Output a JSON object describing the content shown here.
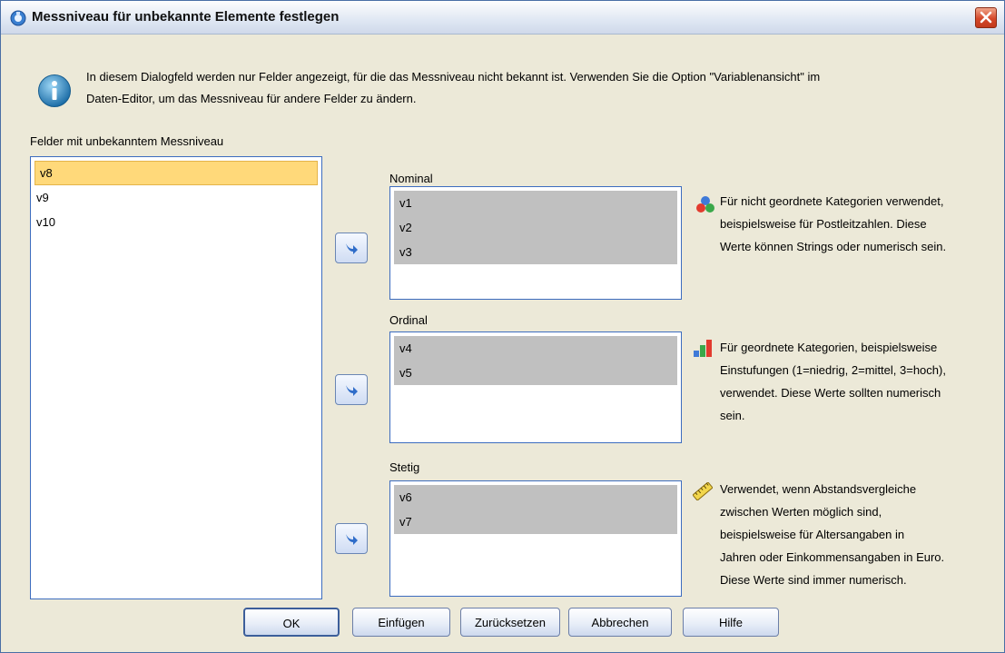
{
  "window": {
    "title": "Messniveau für unbekannte Elemente festlegen",
    "icon": "spss-dialog-icon",
    "close_icon": "close-icon"
  },
  "info": {
    "icon": "info-icon",
    "text_line1": "In diesem Dialogfeld werden nur Felder angezeigt, für die das Messniveau nicht bekannt ist. Verwenden Sie die Option \"Variablenansicht\" im",
    "text_line2": "Daten-Editor, um das Messniveau für andere Felder zu ändern."
  },
  "unknown_fields": {
    "label": "Felder mit unbekanntem Messniveau",
    "items": [
      "v8",
      "v9",
      "v10"
    ],
    "selected": "v8"
  },
  "nominal": {
    "label": "Nominal",
    "items": [
      "v1",
      "v2",
      "v3"
    ],
    "icon": "nominal-icon",
    "desc_lines": [
      "Für nicht geordnete Kategorien verwendet,",
      "beispielsweise für Postleitzahlen. Diese",
      "Werte können Strings oder numerisch sein."
    ]
  },
  "ordinal": {
    "label": "Ordinal",
    "items": [
      "v4",
      "v5"
    ],
    "icon": "ordinal-icon",
    "desc_lines": [
      "Für geordnete Kategorien, beispielsweise",
      "Einstufungen (1=niedrig, 2=mittel, 3=hoch),",
      "verwendet. Diese Werte sollten numerisch",
      "sein."
    ]
  },
  "scale": {
    "label": "Stetig",
    "items": [
      "v6",
      "v7"
    ],
    "icon": "scale-icon",
    "desc_lines": [
      "Verwendet, wenn Abstandsvergleiche",
      "zwischen Werten möglich sind,",
      "beispielsweise für Altersangaben in",
      "Jahren oder Einkommensangaben in Euro.",
      "Diese Werte sind immer numerisch."
    ]
  },
  "buttons": {
    "ok": "OK",
    "paste": "Einfügen",
    "reset": "Zurücksetzen",
    "cancel": "Abbrechen",
    "help": "Hilfe"
  },
  "colors": {
    "selection": "#ffd97a",
    "list_border": "#3c6cbf",
    "dialog_bg": "#ece9d8",
    "assigned_bg": "#c0c0c0"
  }
}
